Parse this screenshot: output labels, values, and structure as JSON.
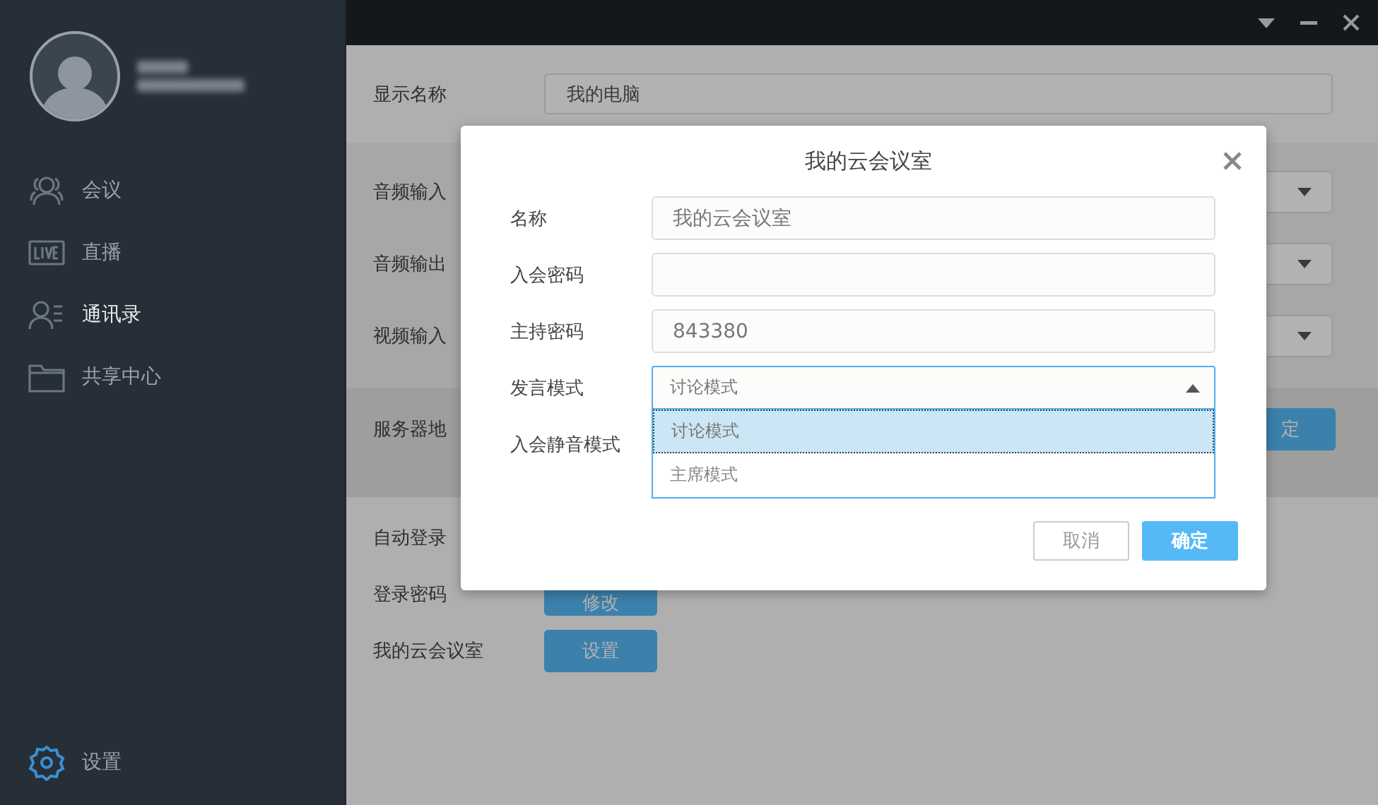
{
  "sidebar": {
    "items": [
      {
        "label": "会议",
        "selected": false
      },
      {
        "label": "直播",
        "selected": false
      },
      {
        "label": "通讯录",
        "selected": true
      },
      {
        "label": "共享中心",
        "selected": false
      }
    ],
    "footer_item": {
      "label": "设置"
    }
  },
  "settings": {
    "display_name": {
      "label": "显示名称",
      "value": "我的电脑"
    },
    "devices": [
      {
        "label": "音频输入"
      },
      {
        "label": "音频输出"
      },
      {
        "label": "视频输入"
      }
    ],
    "server": {
      "label": "服务器地",
      "button": "定"
    },
    "auto_login": {
      "label": "自动登录"
    },
    "login_password": {
      "label": "登录密码",
      "button": "修改"
    },
    "my_room": {
      "label": "我的云会议室",
      "button": "设置"
    }
  },
  "dialog": {
    "title": "我的云会议室",
    "fields": [
      {
        "label": "名称",
        "value": "我的云会议室"
      },
      {
        "label": "入会密码"
      },
      {
        "label": "主持密码",
        "value": "843380"
      }
    ],
    "speech_mode": {
      "label": "发言模式",
      "value": "讨论模式",
      "expanded": true,
      "options": [
        {
          "label": "讨论模式",
          "selected": true
        },
        {
          "label": "主席模式",
          "selected": false
        }
      ]
    },
    "mute_mode": {
      "label": "入会静音模式"
    },
    "buttons": [
      {
        "label": "取消",
        "kind": "secondary"
      },
      {
        "label": "确定",
        "kind": "primary"
      }
    ]
  }
}
